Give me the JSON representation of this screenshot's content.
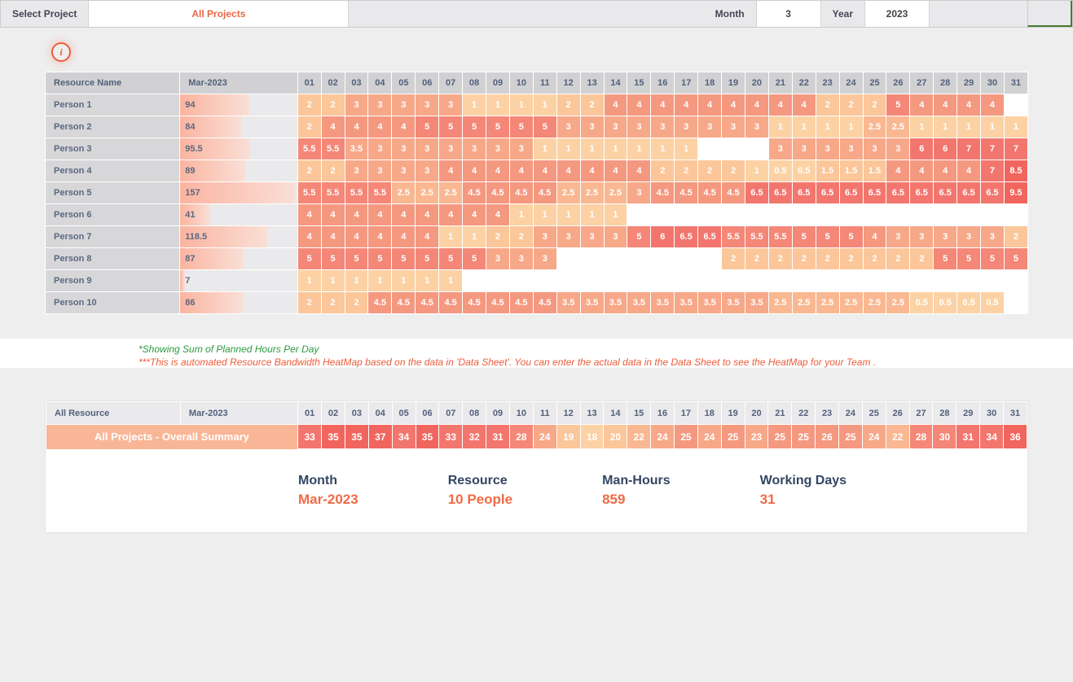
{
  "topbar": {
    "select_project_label": "Select Project",
    "project_value": "All Projects",
    "month_label": "Month",
    "month_value": "3",
    "year_label": "Year",
    "year_value": "2023"
  },
  "heatmap": {
    "header_name": "Resource Name",
    "header_month": "Mar-2023",
    "days": [
      "01",
      "02",
      "03",
      "04",
      "05",
      "06",
      "07",
      "08",
      "09",
      "10",
      "11",
      "12",
      "13",
      "14",
      "15",
      "16",
      "17",
      "18",
      "19",
      "20",
      "21",
      "22",
      "23",
      "24",
      "25",
      "26",
      "27",
      "28",
      "29",
      "30",
      "31"
    ],
    "max_total": 160,
    "rows": [
      {
        "name": "Person 1",
        "total": 94,
        "cells": [
          2,
          2,
          3,
          3,
          3,
          3,
          3,
          1,
          1,
          1,
          1,
          2,
          2,
          4,
          4,
          4,
          4,
          4,
          4,
          4,
          4,
          4,
          2,
          2,
          2,
          5,
          4,
          4,
          4,
          4
        ]
      },
      {
        "name": "Person 2",
        "total": 84,
        "cells": [
          2,
          4,
          4,
          4,
          4,
          5,
          5,
          5,
          5,
          5,
          5,
          3,
          3,
          3,
          3,
          3,
          3,
          3,
          3,
          3,
          1,
          1,
          1,
          1,
          2.5,
          2.5,
          1,
          1,
          1,
          1,
          1
        ]
      },
      {
        "name": "Person 3",
        "total": 95.5,
        "cells": [
          5.5,
          5.5,
          3.5,
          3,
          3,
          3,
          3,
          3,
          3,
          3,
          1,
          1,
          1,
          1,
          1,
          1,
          1,
          null,
          null,
          null,
          3,
          3,
          3,
          3,
          3,
          3,
          6,
          6,
          7,
          7,
          7
        ]
      },
      {
        "name": "Person 4",
        "total": 89,
        "cells": [
          2,
          2,
          3,
          3,
          3,
          3,
          4,
          4,
          4,
          4,
          4,
          4,
          4,
          4,
          4,
          2,
          2,
          2,
          2,
          1,
          0.5,
          0.5,
          1.5,
          1.5,
          1.5,
          4,
          4,
          4,
          4,
          7,
          8.5
        ]
      },
      {
        "name": "Person 5",
        "total": 157,
        "cells": [
          5.5,
          5.5,
          5.5,
          5.5,
          2.5,
          2.5,
          2.5,
          4.5,
          4.5,
          4.5,
          4.5,
          2.5,
          2.5,
          2.5,
          3,
          4.5,
          4.5,
          4.5,
          4.5,
          6.5,
          6.5,
          6.5,
          6.5,
          6.5,
          6.5,
          6.5,
          6.5,
          6.5,
          6.5,
          6.5,
          9.5
        ]
      },
      {
        "name": "Person 6",
        "total": 41,
        "cells": [
          4,
          4,
          4,
          4,
          4,
          4,
          4,
          4,
          4,
          1,
          1,
          1,
          1,
          1
        ]
      },
      {
        "name": "Person 7",
        "total": 118.5,
        "cells": [
          4,
          4,
          4,
          4,
          4,
          4,
          1,
          1,
          2,
          2,
          3,
          3,
          3,
          3,
          5,
          6,
          6.5,
          6.5,
          5.5,
          5.5,
          5.5,
          5,
          5,
          5,
          4,
          3,
          3,
          3,
          3,
          3,
          2
        ]
      },
      {
        "name": "Person 8",
        "total": 87,
        "cells": [
          5,
          5,
          5,
          5,
          5,
          5,
          5,
          5,
          3,
          3,
          3,
          null,
          null,
          null,
          null,
          null,
          null,
          null,
          2,
          2,
          2,
          2,
          2,
          2,
          2,
          2,
          2,
          5,
          5,
          5,
          5
        ]
      },
      {
        "name": "Person 9",
        "total": 7,
        "cells": [
          1,
          1,
          1,
          1,
          1,
          1,
          1
        ]
      },
      {
        "name": "Person 10",
        "total": 86,
        "cells": [
          2,
          2,
          2,
          4.5,
          4.5,
          4.5,
          4.5,
          4.5,
          4.5,
          4.5,
          4.5,
          3.5,
          3.5,
          3.5,
          3.5,
          3.5,
          3.5,
          3.5,
          3.5,
          3.5,
          2.5,
          2.5,
          2.5,
          2.5,
          2.5,
          2.5,
          0.5,
          0.5,
          0.5,
          0.5
        ]
      }
    ]
  },
  "notes": {
    "line1": "*Showing Sum of Planned Hours Per Day",
    "line2": "***This is automated Resource Bandwidth HeatMap based on the data in  'Data Sheet'. You can enter the actual data in the Data Sheet to see the HeatMap for your Team ."
  },
  "summary": {
    "header_left": "All Resource",
    "header_month": "Mar-2023",
    "row_title": "All Projects - Overall Summary",
    "days": [
      "01",
      "02",
      "03",
      "04",
      "05",
      "06",
      "07",
      "08",
      "09",
      "10",
      "11",
      "12",
      "13",
      "14",
      "15",
      "16",
      "17",
      "18",
      "19",
      "20",
      "21",
      "22",
      "23",
      "24",
      "25",
      "26",
      "27",
      "28",
      "29",
      "30",
      "31"
    ],
    "values": [
      33,
      35,
      35,
      37,
      34,
      35,
      33,
      32,
      31,
      28,
      24,
      19,
      18,
      20,
      22,
      24,
      25,
      24,
      25,
      23,
      25,
      25,
      26,
      25,
      24,
      22,
      28,
      30,
      31,
      34,
      36
    ],
    "stats": {
      "month_label": "Month",
      "month_value": "Mar-2023",
      "resource_label": "Resource",
      "resource_value": "10 People",
      "hours_label": "Man-Hours",
      "hours_value": "859",
      "days_label": "Working Days",
      "days_value": "31"
    }
  }
}
